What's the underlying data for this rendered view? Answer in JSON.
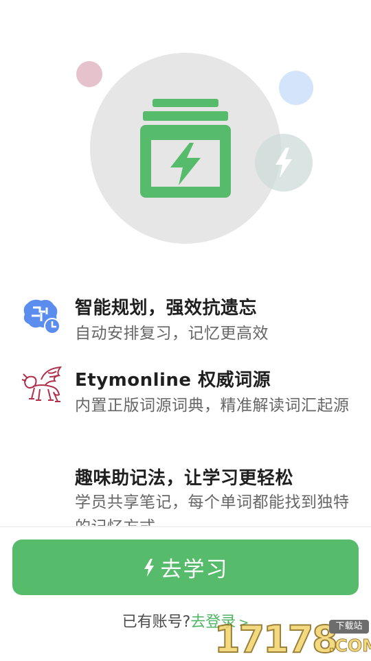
{
  "hero": {
    "illustration_icon": "flashcard-box-lightning-icon",
    "accent_color": "#56bb6b"
  },
  "features": [
    {
      "icon": "brain-clock-icon",
      "title": "智能规划，强效抗遗忘",
      "desc": "自动安排复习，记忆更高效"
    },
    {
      "icon": "winged-lion-logo-icon",
      "title": "Etymonline 权威词源",
      "desc": "内置正版词源词典，精准解读词汇起源"
    },
    {
      "icon": "",
      "title": "趣味助记法，让学习更轻松",
      "desc": "学员共享笔记，每个单词都能找到独特的记忆方式"
    }
  ],
  "primary_button": {
    "label": "去学习",
    "icon": "lightning-icon",
    "color": "#56bb6b"
  },
  "login": {
    "prefix": "已有账号?",
    "link_label": "去登录",
    "chevron": ">"
  },
  "watermark": {
    "number": "17178",
    "badge": "下载站",
    "suffix": ".COM"
  }
}
